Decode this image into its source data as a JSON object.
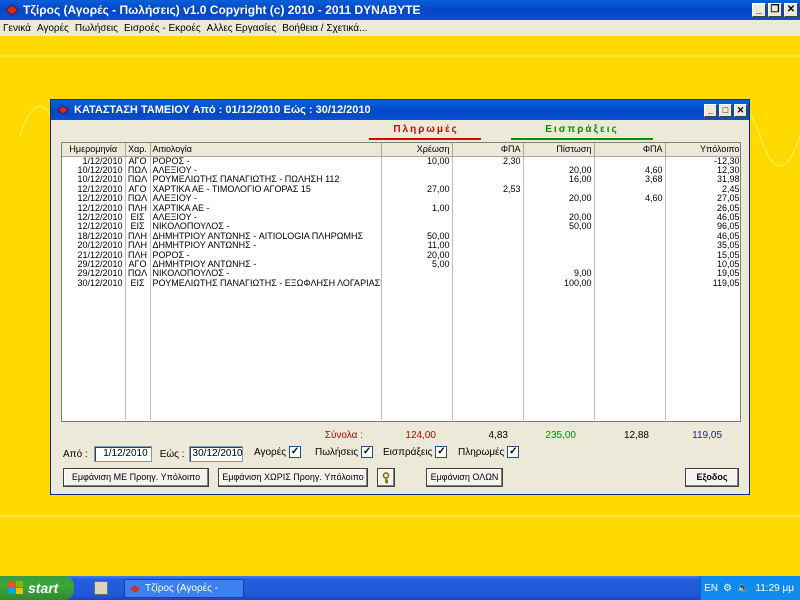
{
  "app": {
    "title": "Τζίρος (Αγορές - Πωλήσεις) v1.0 Copyright (c) 2010 - 2011 DYNABYTE",
    "menu": [
      "Γενικά",
      "Αγορές",
      "Πωλήσεις",
      "Εισροές - Εκροές",
      "Αλλες Εργασίες",
      "Βοήθεια / Σχετικά..."
    ]
  },
  "dialog": {
    "title": "ΚΑΤΑΣΤΑΣΗ ΤΑΜΕΙΟΥ Από : 01/12/2010 Εώς : 30/12/2010",
    "group_payments": "Πληρωμές",
    "group_receipts": "Εισπράξεις",
    "columns": [
      "Ημερομηνία",
      "Χαρ.",
      "Αιτιολογία",
      "Χρέωση",
      "ΦΠΑ",
      "Πίστωση",
      "ΦΠΑ",
      "Υπόλοιπο"
    ],
    "rows": [
      [
        "1/12/2010",
        "ΑΓΟ",
        "ΡΟΡΟΣ -",
        "10,00",
        "2,30",
        "",
        "",
        "-12,30"
      ],
      [
        "10/12/2010",
        "ΠΩΛ",
        "ΑΛΕΞΙΟΥ -",
        "",
        "",
        "20,00",
        "4,60",
        "12,30"
      ],
      [
        "10/12/2010",
        "ΠΩΛ",
        "ΡΟΥΜΕΛΙΩΤΗΣ ΠΑΝΑΓΙΩΤΗΣ - ΠΩΛΗΣΗ 112",
        "",
        "",
        "16,00",
        "3,68",
        "31,98"
      ],
      [
        "12/12/2010",
        "ΑΓΟ",
        "ΧΑΡΤΙΚΑ ΑΕ - ΤΙΜΟΛΟΓΙΟ ΑΓΟΡΑΣ 15",
        "27,00",
        "2,53",
        "",
        "",
        "2,45"
      ],
      [
        "12/12/2010",
        "ΠΩΛ",
        "ΑΛΕΞΙΟΥ -",
        "",
        "",
        "20,00",
        "4,60",
        "27,05"
      ],
      [
        "12/12/2010",
        "ΠΛΗ",
        "ΧΑΡΤΙΚΑ ΑΕ -",
        "1,00",
        "",
        "",
        "",
        "26,05"
      ],
      [
        "12/12/2010",
        "ΕΙΣ",
        "ΑΛΕΞΙΟΥ -",
        "",
        "",
        "20,00",
        "",
        "46,05"
      ],
      [
        "12/12/2010",
        "ΕΙΣ",
        "ΝΙΚΟΛΟΠΟΥΛΟΣ -",
        "",
        "",
        "50,00",
        "",
        "96,05"
      ],
      [
        "18/12/2010",
        "ΠΛΗ",
        "ΔΗΜΗΤΡΙΟΥ ΑΝΤΩΝΗΣ - AITIOLOGIA ΠΛΗΡΩΜΗΣ",
        "50,00",
        "",
        "",
        "",
        "46,05"
      ],
      [
        "20/12/2010",
        "ΠΛΗ",
        "ΔΗΜΗΤΡΙΟΥ ΑΝΤΩΝΗΣ -",
        "11,00",
        "",
        "",
        "",
        "35,05"
      ],
      [
        "21/12/2010",
        "ΠΛΗ",
        "ΡΟΡΟΣ -",
        "20,00",
        "",
        "",
        "",
        "15,05"
      ],
      [
        "29/12/2010",
        "ΑΓΟ",
        "ΔΗΜΗΤΡΙΟΥ ΑΝΤΩΝΗΣ -",
        "5,00",
        "",
        "",
        "",
        "10,05"
      ],
      [
        "29/12/2010",
        "ΠΩΛ",
        "ΝΙΚΟΛΟΠΟΥΛΟΣ -",
        "",
        "",
        "9,00",
        "",
        "19,05"
      ],
      [
        "30/12/2010",
        "ΕΙΣ",
        "ΡΟΥΜΕΛΙΩΤΗΣ ΠΑΝΑΓΙΩΤΗΣ - ΕΞΩΦΛΗΣΗ ΛΟΓΑΡΙΑΣΜΟ",
        "",
        "",
        "100,00",
        "",
        "119,05"
      ]
    ],
    "totals": {
      "label": "Σύνολα :",
      "charge": "124,00",
      "charge_vat": "4,83",
      "credit": "235,00",
      "credit_vat": "12,88",
      "balance": "119,05"
    },
    "filters": {
      "from_label": "Από :",
      "from_value": "1/12/2010",
      "to_label": "Εώς :",
      "to_value": "30/12/2010",
      "purchases_label": "Αγορές",
      "sales_label": "Πωλήσεις",
      "receipts_label": "Εισπράξεις",
      "payments_label": "Πληρωμές"
    },
    "buttons": {
      "with_prev": "Εμφάνιση ΜΕ Προηγ. Υπόλοιπο",
      "without_prev": "Εμφάνιση ΧΩΡΙΣ Προηγ. Υπόλοιπο",
      "show_all": "Εμφάνιση ΟΛΩΝ",
      "exit": "Εξοδος"
    }
  },
  "taskbar": {
    "start": "start",
    "task": "Τζίρος (Αγορές - Πωλ...",
    "lang": "EN",
    "clock": "11:29 μμ"
  },
  "colors": {
    "background": "#ffda00",
    "payments": "#e00000",
    "receipts": "#009000",
    "balance": "#1a1a9c"
  }
}
